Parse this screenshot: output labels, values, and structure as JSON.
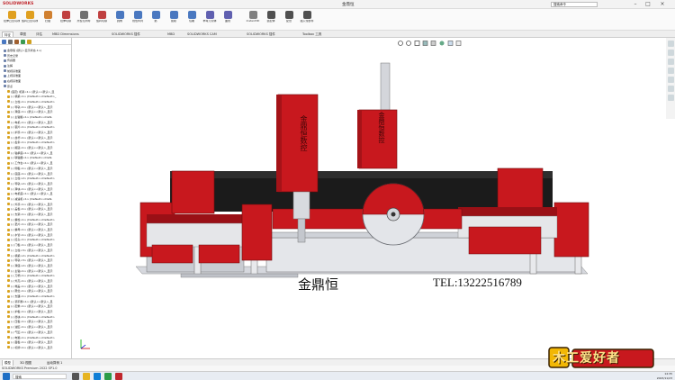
{
  "app": {
    "brand": "SOLIDWORKS",
    "document_title": "金鼎恒",
    "search_placeholder": "搜索命令"
  },
  "ribbon": [
    {
      "label": "拉伸凸台/基体",
      "color": "#e0a020"
    },
    {
      "label": "旋转凸台/基体",
      "color": "#e0a020"
    },
    {
      "label": "扫描",
      "color": "#d08030"
    },
    {
      "label": "拉伸切除",
      "color": "#c04040"
    },
    {
      "label": "异型孔向导",
      "color": "#707070"
    },
    {
      "label": "旋转切除",
      "color": "#c04040"
    },
    {
      "label": "圆角",
      "color": "#4a78c0"
    },
    {
      "label": "线性阵列",
      "color": "#4a78c0"
    },
    {
      "label": "筋",
      "color": "#4a78c0"
    },
    {
      "label": "拔模",
      "color": "#4a78c0"
    },
    {
      "label": "包覆",
      "color": "#4a78c0"
    },
    {
      "label": "参考几何体",
      "color": "#6060b0"
    },
    {
      "label": "曲线",
      "color": "#6060b0"
    },
    {
      "label": "Instant3D",
      "color": "#808080"
    },
    {
      "label": "装配体",
      "color": "#505050"
    },
    {
      "label": "配合",
      "color": "#505050"
    },
    {
      "label": "插入零部件",
      "color": "#505050"
    }
  ],
  "tabs": [
    "特征",
    "草图",
    "评估",
    "MBD Dimensions",
    "SOLIDWORKS 插件",
    "MBD",
    "SOLIDWORKS CAM",
    "SOLIDWORKS 插件",
    "Toolbox 工具"
  ],
  "tree": [
    "金鼎恒 (默认<显示状态-1>)",
    "历史记录",
    "传感器",
    "注解",
    "前视基准面",
    "上视基准面",
    "右视基准面",
    "原点",
    "(固定) 机架<1> (默认<<默认>_显",
    "(-) 横梁<1> (Default<<Default>_",
    "(-) 立柱<1> (Default<<Default>",
    "(-) 导轨<1> (默认<<默认>_显示",
    "(-) 滑座<1> (默认<<默认>_显示",
    "(-) 主轴箱<1> (Default<<Defa",
    "(-) 电机<1> (默认<<默认>_显示",
    "(-) 锯片<1> (Default<<Default>",
    "(-) 护罩<1> (默认<<默认>_显示",
    "(-) 丝杆<1> (默认<<默认>_显示",
    "(-) 齿条<1> (Default<<Default>",
    "(-) 拖链<1> (默认<<默认>_显示",
    "(-) 轴承座<1> (默认<<默认>_显",
    "(-) 联轴器<1> (Default<<Defa",
    "(-) 工作台<1> (默认<<默认>_显",
    "(-) 侧板<1> (默认<<默认>_显示",
    "(-) 底座<1> (默认<<默认>_显示",
    "(-) 立柱<2> (Default<<Default>",
    "(-) 导轨<2> (默认<<默认>_显示",
    "(-) 滑块<1> (默认<<默认>_显示",
    "(-) 电机座<1> (默认<<默认>_显",
    "(-) 减速机<1> (Default<<Defa",
    "(-) 外罩<1> (默认<<默认>_显示",
    "(-) 盖板<1> (默认<<默认>_显示",
    "(-) 支架<1> (默认<<默认>_显示",
    "(-) 螺栓<1> (Default<<Default>",
    "(-) 垫片<1> (默认<<默认>_显示",
    "(-) 螺母<1> (默认<<默认>_显示",
    "(-) 水管<1> (默认<<默认>_显示",
    "(-) 接头<1> (Default<<Default>",
    "(-) 门板<1> (默认<<默认>_显示",
    "(-) 立柱<3> (默认<<默认>_显示",
    "(-) 横梁<2> (Default<<Default>",
    "(-) 导轨<3> (默认<<默认>_显示",
    "(-) 滑座<2> (默认<<默认>_显示",
    "(-) 主轴<1> (默认<<默认>_显示",
    "(-) 刀柄<1> (Default<<Default>",
    "(-) 外壳<1> (默认<<默认>_显示",
    "(-) 端盖<1> (默认<<默认>_显示",
    "(-) 限位<1> (默认<<默认>_显示",
    "(-) 支腿<1> (Default<<Default>",
    "(-) 调平脚<1> (默认<<默认>_显",
    "(-) 配重<1> (默认<<默认>_显示",
    "(-) 护板<1> (默认<<默认>_显示",
    "(-) 挡块<1> (Default<<Default>",
    "(-) 压板<1> (默认<<默认>_显示",
    "(-) 油缸<1> (默认<<默认>_显示",
    "(-) 气缸<1> (默认<<默认>_显示",
    "(-) 电箱<1> (Default<<Default>",
    "(-) 面板<1> (默认<<默认>_显示",
    "(-) 标牌<1> (默认<<默认>_显示"
  ],
  "machine": {
    "brand_text": "金鼎恒",
    "head_left_text": "金鼎恒数控",
    "head_right_text": "金鼎恒数控",
    "phone_text": "TEL:13222516789"
  },
  "bottom_tabs": [
    "模型",
    "3D 视图",
    "运动算例 1"
  ],
  "status": "SOLIDWORKS Premium 2022 SP1.0",
  "taskbar": {
    "search": "搜索",
    "time": "14:35",
    "date": "2023/11/23"
  },
  "watermark": {
    "text": "木工爱好者"
  },
  "colors": {
    "machine_red": "#c8181e",
    "dark_red": "#8f0e12",
    "beam_black": "#1b1b1b",
    "frame_grey": "#cfd2d8"
  }
}
